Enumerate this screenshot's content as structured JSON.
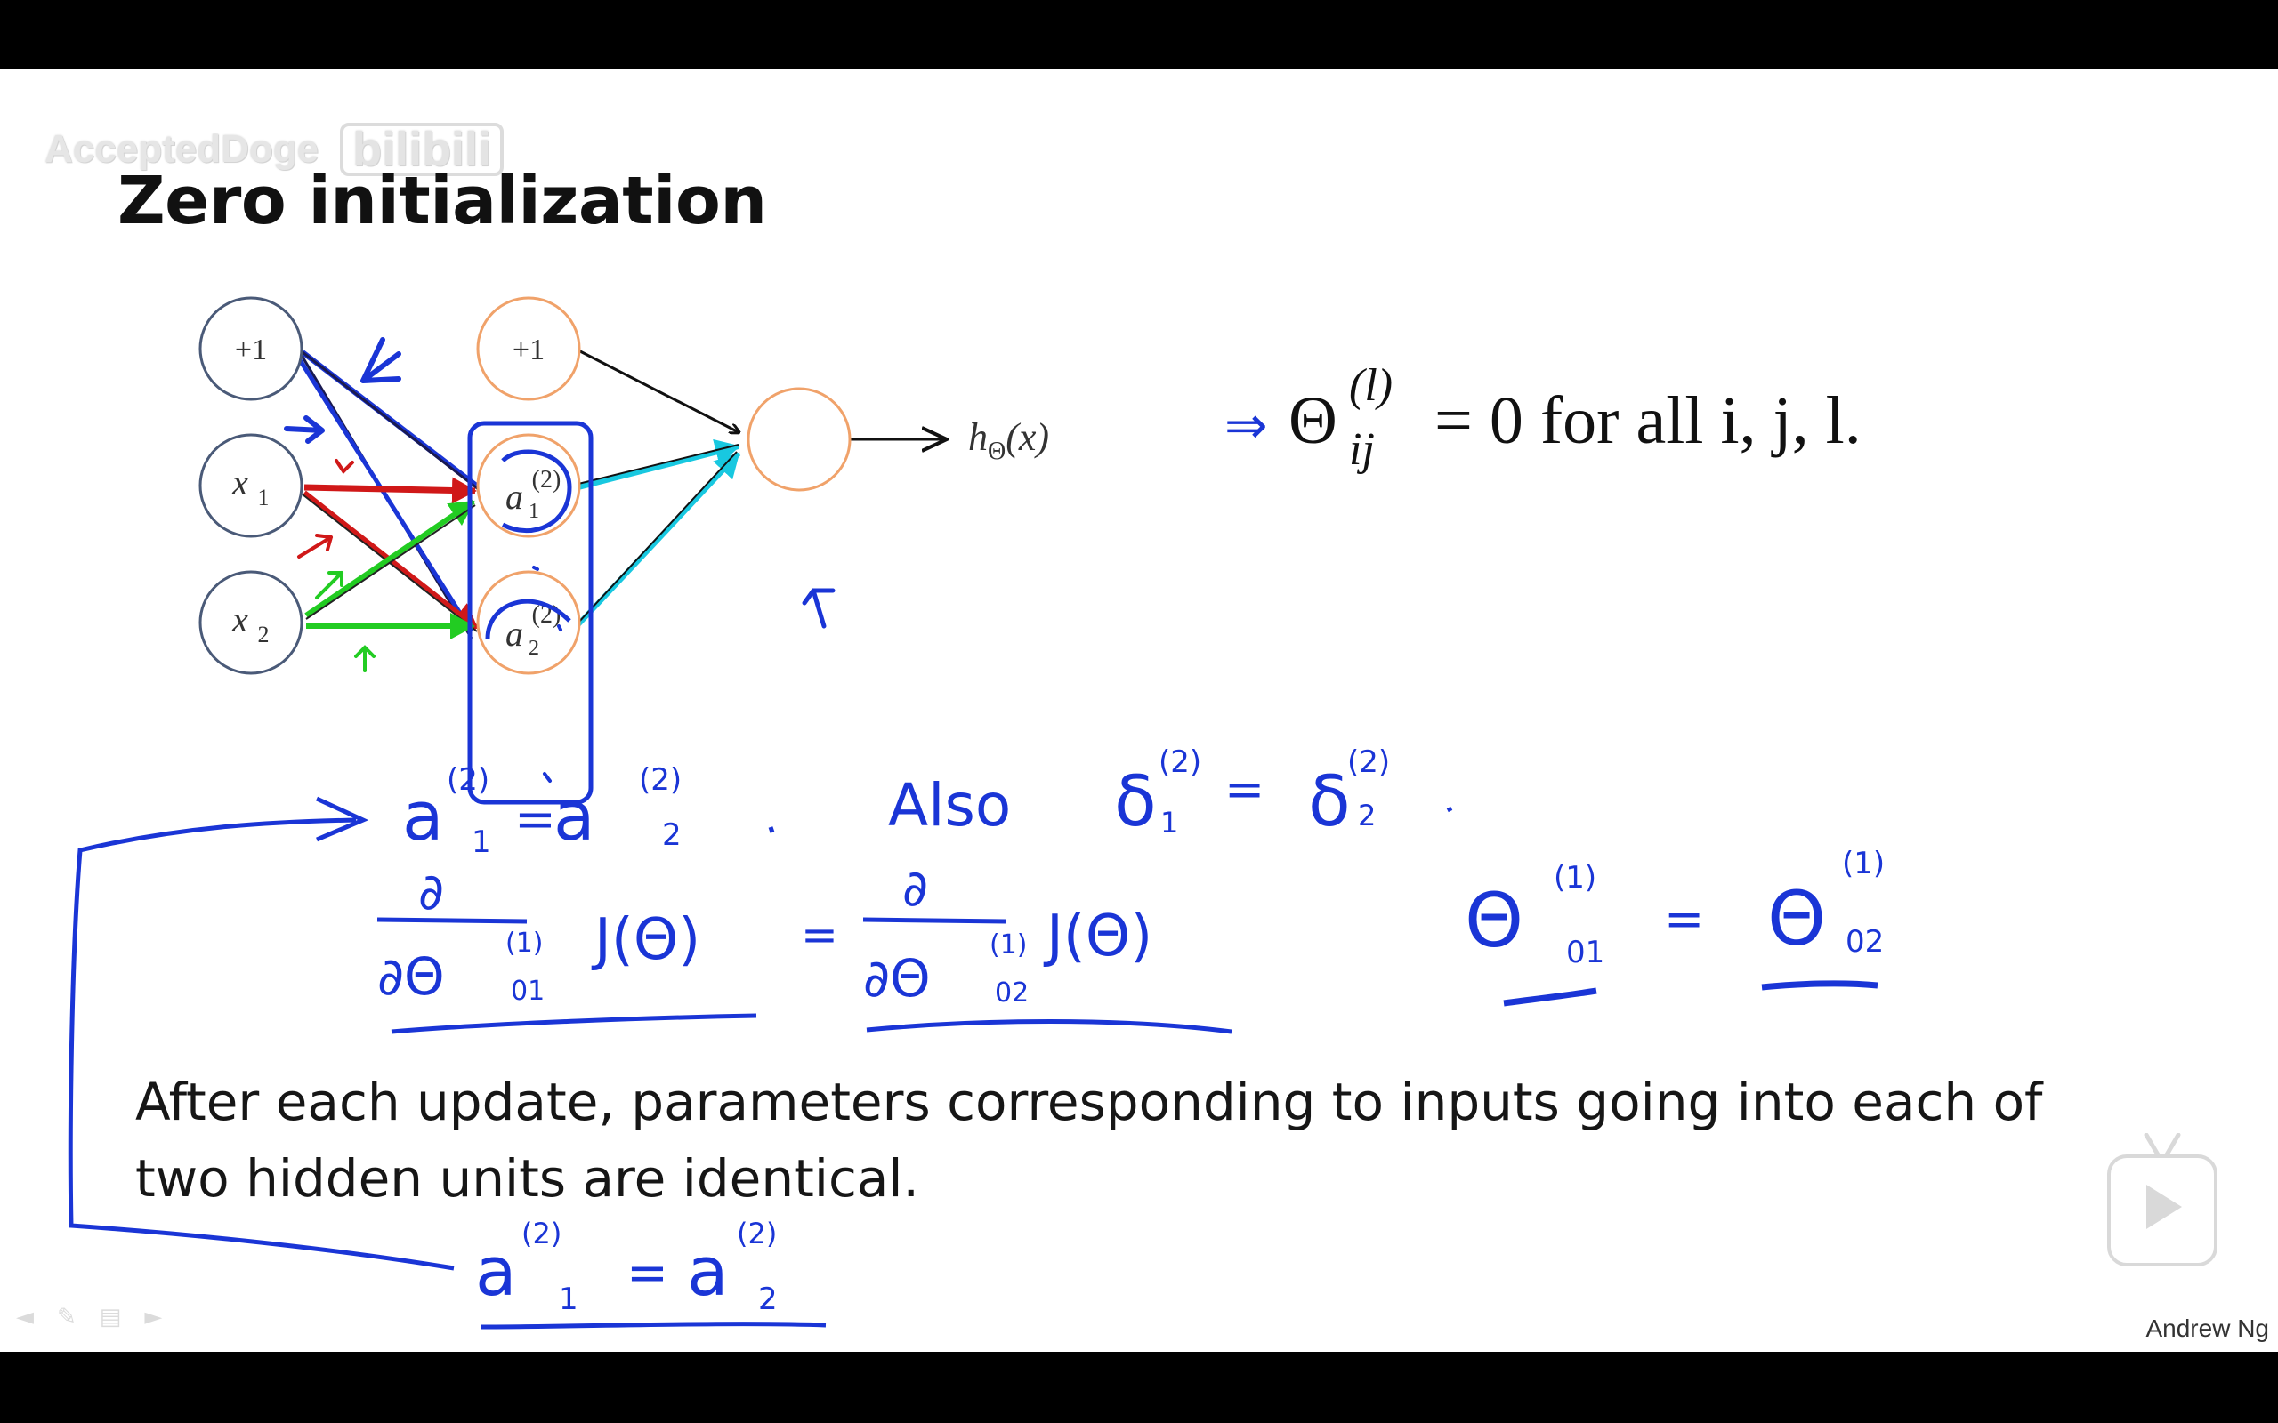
{
  "watermark": {
    "text": "AcceptedDoge",
    "logo": "bilibili"
  },
  "slide": {
    "title": "Zero initialization",
    "network": {
      "input_bias": "+1",
      "input_x1": "x",
      "input_x1_sub": "1",
      "input_x2": "x",
      "input_x2_sub": "2",
      "hidden_bias": "+1",
      "hidden_a1": "a",
      "hidden_a1_sup": "(2)",
      "hidden_a1_sub": "1",
      "hidden_a2": "a",
      "hidden_a2_sup": "(2)",
      "hidden_a2_sub": "2",
      "output_label": "h",
      "output_label_sub": "Θ",
      "output_label_arg": "(x)"
    },
    "formula": {
      "arrow": "⇒",
      "theta": "Θ",
      "sup": "(l)",
      "sub": "ij",
      "rest": "= 0 for all i, j, l."
    },
    "handwriting": {
      "line1_left": "a",
      "line1_sup": "(2)",
      "line1_sub1": "1",
      "line1_eq": "=",
      "line1_right": "a",
      "line1_sub2": "2",
      "also": "Also",
      "delta": "δ",
      "delta_sup": "(2)",
      "delta_sub1": "1",
      "delta_sub2": "2",
      "partial": "∂",
      "partial_den1": "∂Θ",
      "den_sup": "(1)",
      "den_sub1": "01",
      "den_sub2": "02",
      "j_theta": "J(Θ)",
      "theta_big": "Θ",
      "theta_sup": "(1)",
      "theta_sub1": "01",
      "theta_sub2": "02",
      "bottom_left": "a",
      "bottom_sup": "(2)",
      "bottom_sub1": "1",
      "bottom_eq": "=",
      "bottom_right": "a",
      "bottom_sub2": "2"
    },
    "body_text": "After each update, parameters corresponding to inputs going into each of two hidden units are identical.",
    "author": "Andrew Ng"
  },
  "player": {
    "play_icon": "play-icon",
    "controls": [
      "rewind-icon",
      "pen-icon",
      "menu-icon",
      "forward-icon"
    ]
  },
  "colors": {
    "node_blue": "#4a5a78",
    "node_orange": "#f0a26a",
    "ink_blue": "#1a35d6",
    "red": "#d01818",
    "green": "#22cc22",
    "cyan": "#18c8e0",
    "black": "#111111"
  }
}
